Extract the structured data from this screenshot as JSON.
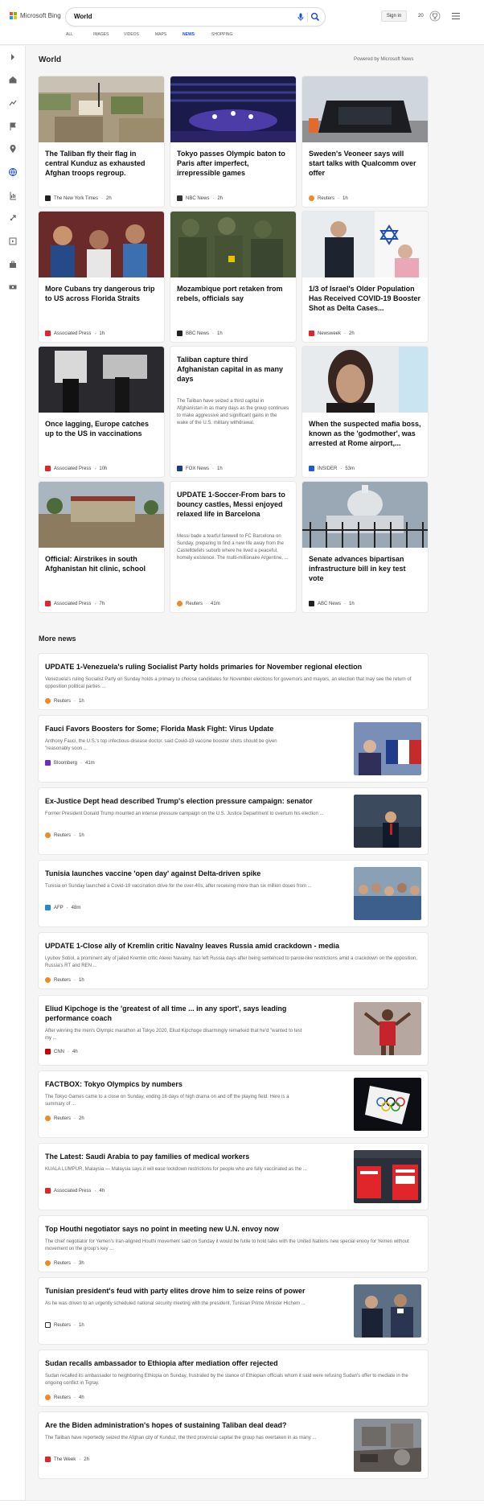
{
  "header": {
    "logo_text": "Microsoft Bing",
    "search_value": "World",
    "signin_label": "Sign in",
    "rewards_count": "20"
  },
  "tabs": [
    {
      "label": "ALL"
    },
    {
      "label": "IMAGES"
    },
    {
      "label": "VIDEOS"
    },
    {
      "label": "MAPS"
    },
    {
      "label": "NEWS",
      "active": true
    },
    {
      "label": "SHOPPING"
    }
  ],
  "section": {
    "title": "World",
    "powered": "Powered by Microsoft News"
  },
  "cards": [
    {
      "headline": "The Taliban fly their flag in central Kunduz as exhausted Afghan troops regroup.",
      "source": "The New York Times",
      "age": "2h",
      "summary": ""
    },
    {
      "headline": "Tokyo passes Olympic baton to Paris after imperfect, irrepressible games",
      "source": "NBC News",
      "age": "2h",
      "summary": ""
    },
    {
      "headline": "Sweden's Veoneer says will start talks with Qualcomm over offer",
      "source": "Reuters",
      "age": "1h",
      "summary": ""
    },
    {
      "headline": "More Cubans try dangerous trip to US across Florida Straits",
      "source": "Associated Press",
      "age": "1h",
      "summary": ""
    },
    {
      "headline": "Mozambique port retaken from rebels, officials say",
      "source": "BBC News",
      "age": "1h",
      "summary": ""
    },
    {
      "headline": "1/3 of Israel's Older Population Has Received COVID-19 Booster Shot as Delta Cases...",
      "source": "Newsweek",
      "age": "2h",
      "summary": ""
    },
    {
      "headline": "Once lagging, Europe catches up to the US in vaccinations",
      "source": "Associated Press",
      "age": "10h",
      "summary": ""
    },
    {
      "headline": "Taliban capture third Afghanistan capital in as many days",
      "source": "FOX News",
      "age": "1h",
      "summary": "The Taliban have seized a third capital in Afghanistan in as many days as the group continues to make aggressive and significant gains in the wake of the U.S. military withdrawal."
    },
    {
      "headline": "When the suspected mafia boss, known as the 'godmother', was arrested at Rome airport,...",
      "source": "INSIDER",
      "age": "53m",
      "summary": ""
    },
    {
      "headline": "Official: Airstrikes in south Afghanistan hit clinic, school",
      "source": "Associated Press",
      "age": "7h",
      "summary": ""
    },
    {
      "headline": "UPDATE 1-Soccer-From bars to bouncy castles, Messi enjoyed relaxed life in Barcelona",
      "source": "Reuters",
      "age": "41m",
      "summary": "Messi bade a tearful farewell to FC Barcelona on Sunday, preparing to find a new life away from the Castelldefels suburb where he lived a peaceful, homely existence. The multi-millionaire Argentine, ..."
    },
    {
      "headline": "Senate advances bipartisan infrastructure bill in key test vote",
      "source": "ABC News",
      "age": "1h",
      "summary": ""
    }
  ],
  "more_news": {
    "title": "More news",
    "items": [
      {
        "headline": "UPDATE 1-Venezuela's ruling Socialist Party holds primaries for November regional election",
        "summary": "Venezuela's ruling Socialist Party on Sunday holds a primary to choose candidates for November elections for governors and mayors, an election that may see the return of opposition political parties ...",
        "source": "Reuters",
        "age": "1h",
        "has_image": false
      },
      {
        "headline": "Fauci Favors Boosters for Some; Florida Mask Fight: Virus Update",
        "summary": "Anthony Fauci, the U.S.'s top infectious-disease doctor, said Covid-19 vaccine booster shots should be given \"reasonably soon ...",
        "source": "Bloomberg",
        "age": "41m",
        "has_image": true
      },
      {
        "headline": "Ex-Justice Dept head described Trump's election pressure campaign: senator",
        "summary": "Former President Donald Trump mounted an intense pressure campaign on the U.S. Justice Department to overturn his election ...",
        "source": "Reuters",
        "age": "1h",
        "has_image": true
      },
      {
        "headline": "Tunisia launches vaccine 'open day' against Delta-driven spike",
        "summary": "Tunisia on Sunday launched a Covid-19 vaccination drive for the over-40s, after receiving more than six million doses from ...",
        "source": "AFP",
        "age": "48m",
        "has_image": true
      },
      {
        "headline": "UPDATE 1-Close ally of Kremlin critic Navalny leaves Russia amid crackdown - media",
        "summary": "Lyubov Sobol, a prominent ally of jailed Kremlin critic Alexei Navalny, has left Russia days after being sentenced to parole-like restrictions amid a crackdown on the opposition, Russia's RT and REN ...",
        "source": "Reuters",
        "age": "1h",
        "has_image": false
      },
      {
        "headline": "Eliud Kipchoge is the 'greatest of all time ... in any sport', says leading performance coach",
        "summary": "After winning the men's Olympic marathon at Tokyo 2020, Eliud Kipchoge disarmingly remarked that he'd \"wanted to test my ...",
        "source": "CNN",
        "age": "4h",
        "has_image": true
      },
      {
        "headline": "FACTBOX: Tokyo Olympics by numbers",
        "summary": "The Tokyo Games came to a close on Sunday, ending 16 days of high drama on and off the playing field. Here is a summary of ...",
        "source": "Reuters",
        "age": "2h",
        "has_image": true
      },
      {
        "headline": "The Latest: Saudi Arabia to pay families of medical workers",
        "summary": "KUALA LUMPUR, Malaysia — Malaysia says it will ease lockdown restrictions for people who are fully vaccinated as the ...",
        "source": "Associated Press",
        "age": "4h",
        "has_image": true
      },
      {
        "headline": "Top Houthi negotiator says no point in meeting new U.N. envoy now",
        "summary": "The chief negotiator for Yemen's Iran-aligned Houthi movement said on Sunday it would be futile to hold talks with the United Nations new special envoy for Yemen without movement on the group's key ...",
        "source": "Reuters",
        "age": "3h",
        "has_image": false
      },
      {
        "headline": "Tunisian president's feud with party elites drove him to seize reins of power",
        "summary": "As he was driven to an urgently scheduled national security meeting with the president, Tunisian Prime Minister Hichem ...",
        "source": "Reuters",
        "age": "1h",
        "has_image": true
      },
      {
        "headline": "Sudan recalls ambassador to Ethiopia after mediation offer rejected",
        "summary": "Sudan recalled its ambassador to neighboring Ethiopia on Sunday, frustrated by the stance of Ethiopian officials whom it said were refusing Sudan's offer to mediate in the ongoing conflict in Tigray.",
        "source": "Reuters",
        "age": "4h",
        "has_image": false
      },
      {
        "headline": "Are the Biden administration's hopes of sustaining Taliban deal dead?",
        "summary": "The Taliban have reportedly seized the Afghan city of Kunduz, the third provincial capital the group has overtaken in as many ...",
        "source": "The Week",
        "age": "2h",
        "has_image": true
      }
    ]
  },
  "colors": {
    "accent": "#174ae4",
    "reuters": "#f08a24",
    "ap": "#e0262b"
  }
}
